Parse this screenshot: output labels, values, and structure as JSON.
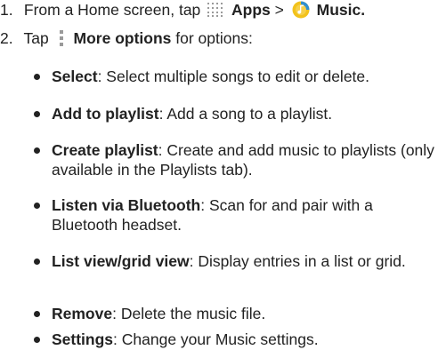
{
  "steps": [
    {
      "number": "1.",
      "prefix": "From a Home screen, tap",
      "apps_label": "Apps",
      "separator": ">",
      "music_label": "Music."
    },
    {
      "number": "2.",
      "prefix": "Tap",
      "more_label": "More options",
      "suffix": "for options:"
    }
  ],
  "options": [
    {
      "term": "Select",
      "description": ": Select multiple songs to edit or delete."
    },
    {
      "term": "Add to playlist",
      "description": ": Add a song to a playlist."
    },
    {
      "term": "Create playlist",
      "description": ": Create and add music to playlists (only available in the Playlists tab)."
    },
    {
      "term": "Listen via Bluetooth",
      "description": ": Scan for and pair with a Bluetooth headset."
    },
    {
      "term": "List view/grid view",
      "description": ": Display entries in a list or grid."
    },
    {
      "term": "Remove",
      "description": ": Delete the music file."
    },
    {
      "term": "Settings",
      "description": ": Change your Music settings."
    }
  ],
  "icons": {
    "apps": "apps-grid-icon",
    "music": "music-app-icon",
    "more": "more-options-icon"
  },
  "colors": {
    "text": "#222222",
    "icon_gray": "#9a9a9a",
    "music_yellow": "#f2c21b",
    "music_blue": "#2f8fd0"
  }
}
